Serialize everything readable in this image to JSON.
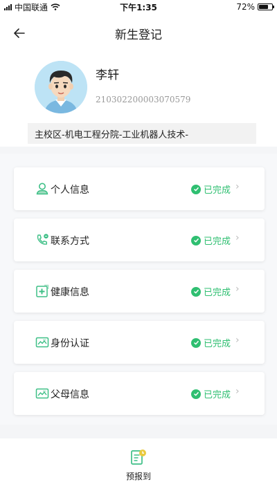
{
  "status_bar": {
    "carrier": "中国联通",
    "time": "下午1:35",
    "battery": "72%",
    "battery_level": 0.72
  },
  "header": {
    "title": "新生登记"
  },
  "student": {
    "name": "李轩",
    "id": "210302200003070579",
    "department": "主校区-机电工程分院-工业机器人技术-"
  },
  "items": [
    {
      "label": "个人信息",
      "status": "已完成",
      "icon": "person-icon"
    },
    {
      "label": "联系方式",
      "status": "已完成",
      "icon": "phone-icon"
    },
    {
      "label": "健康信息",
      "status": "已完成",
      "icon": "health-icon"
    },
    {
      "label": "身份认证",
      "status": "已完成",
      "icon": "id-card-icon"
    },
    {
      "label": "父母信息",
      "status": "已完成",
      "icon": "id-card-icon"
    }
  ],
  "bottom": {
    "label": "预报到",
    "icon": "checklist-clock-icon"
  },
  "colors": {
    "accent_green": "#2fbf71",
    "icon_green": "#3dbf86"
  }
}
